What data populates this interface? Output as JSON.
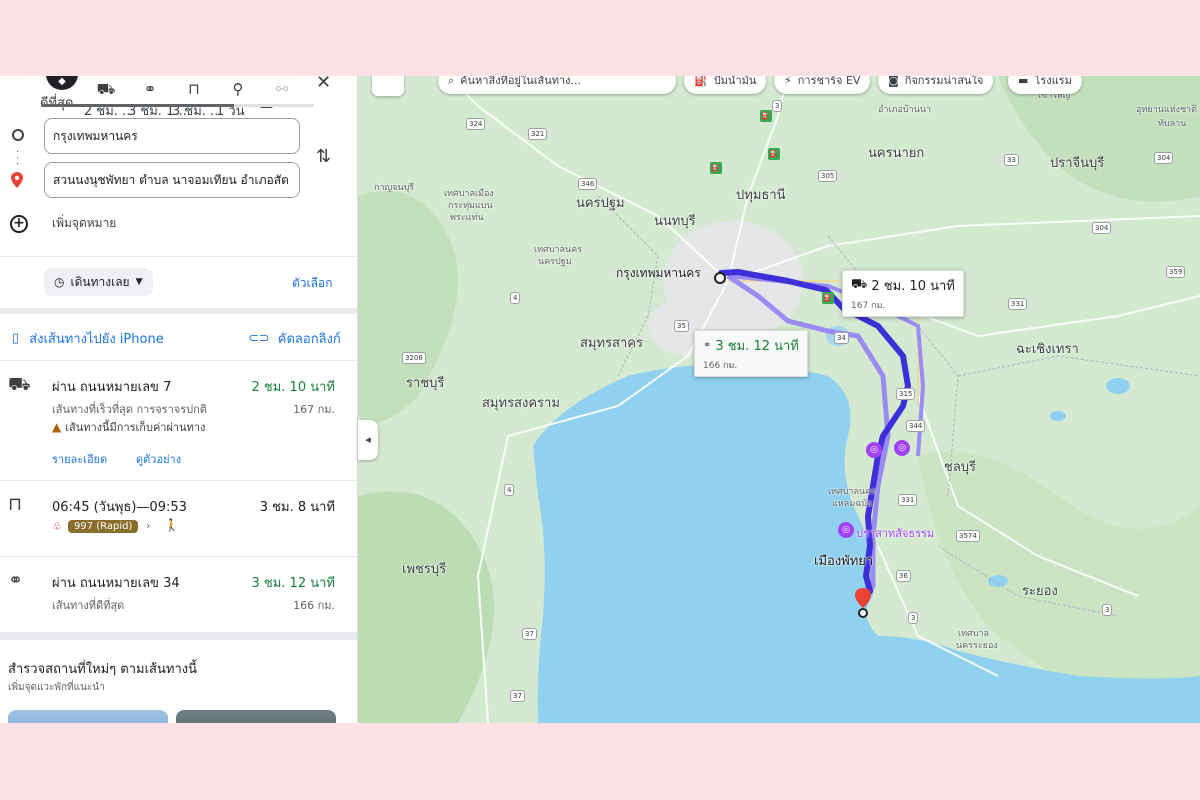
{
  "sidebar": {
    "modes": [
      {
        "label": "ดีที่สุด",
        "icon": "best-route-icon",
        "glyph": "◆"
      },
      {
        "label": "2 ชม. ...",
        "icon": "car-icon",
        "glyph": "🚗"
      },
      {
        "label": "3 ชม. 1...",
        "icon": "motorcycle-icon",
        "glyph": "🏍"
      },
      {
        "label": "3 ชม. ...",
        "icon": "transit-icon",
        "glyph": "🚆"
      },
      {
        "label": "1 วัน",
        "icon": "walking-icon",
        "glyph": "🚶"
      },
      {
        "label": "—",
        "icon": "bicycle-icon",
        "glyph": "🚲"
      }
    ],
    "origin": "กรุงเทพมหานคร",
    "destination": "สวนนงนุชพัทยา ตำบล นาจอมเทียน อำเภอสัต",
    "add_destination": "เพิ่มจุดหมาย",
    "depart_label": "เดินทางเลย",
    "options_label": "ตัวเลือก",
    "send_to_phone": "ส่งเส้นทางไปยัง iPhone",
    "copy_link": "คัดลอกลิงก์",
    "routes": [
      {
        "title": "ผ่าน ถนนหมายเลข 7",
        "time": "2 ชม. 10 นาที",
        "subtitle": "เส้นทางที่เร็วที่สุด การจราจรปกติ",
        "distance": "167 กม.",
        "warning": "เส้นทางนี้มีการเก็บค่าผ่านทาง",
        "details": "รายละเอียด",
        "preview": "ดูตัวอย่าง"
      },
      {
        "title": "06:45 (วันพุธ)—09:53",
        "time": "3 ชม. 8 นาที",
        "bus": "997 (Rapid)"
      },
      {
        "title": "ผ่าน ถนนหมายเลข 34",
        "time": "3 ชม. 12 นาที",
        "subtitle": "เส้นทางที่ดีที่สุด",
        "distance": "166 กม."
      }
    ],
    "explore_title": "สำรวจสถานที่ใหม่ๆ ตามเส้นทางนี้",
    "explore_sub": "เพิ่มจุดแวะพักที่แนะนำ"
  },
  "map": {
    "search_placeholder": "ค้นหาสิ่งที่อยู่ในเส้นทาง...",
    "chips": [
      "ปั๊มน้ำมัน",
      "การชาร์จ EV",
      "กิจกรรมน่าสนใจ",
      "โรงแรม"
    ],
    "callout_main": {
      "time": "2 ชม. 10 นาที",
      "distance": "167 กม."
    },
    "callout_alt": {
      "time": "3 ชม. 12 นาที",
      "distance": "166 กม."
    },
    "labels": {
      "bangkok": "กรุงเทพมหานคร",
      "pathum": "ปทุมธานี",
      "nonthaburi": "นนทบุรี",
      "nakhon_pathom": "นครปฐม",
      "samut_sakhon": "สมุทรสาคร",
      "samut_songkhram": "สมุทรสงคราม",
      "ratchaburi": "ราชบุรี",
      "phetchaburi": "เพชรบุรี",
      "nakhon_nayok": "นครนายก",
      "prachinburi": "ปราจีนบุรี",
      "chachoengsao": "ฉะเชิงเทรา",
      "chonburi": "ชลบุรี",
      "rayong": "ระยอง",
      "pattaya": "เมืองพัทยา",
      "sanctuary": "ปราสาทสัจธรรม",
      "kanchanaburi": "กาญจนบุรี",
      "t_muang": "เทศบาลเมือง",
      "t_kratumbaen": "กระทุ่มแบน",
      "t_prapadaeng": "พระแท่น",
      "t_nakhon": "เทศบาลนคร",
      "t_nakhonpathom": "นครปฐม",
      "t_laemchabang": "แหลมฉบัง",
      "t_nakhonrayong": "นครระยอง",
      "t_ban_na": "อำเภอบ้านนา",
      "t_khao_yai": "เขาใหญ่",
      "t_uthai": "อุทยานแห่งชาติ",
      "t_thap_lan": "ทับลาน",
      "t_nakhonlaem": "เทศบาลนคร",
      "t_rayong_mun": "เทศบาล"
    },
    "shields": [
      "324",
      "321",
      "346",
      "305",
      "3",
      "33",
      "304",
      "304",
      "359",
      "331",
      "4",
      "35",
      "34",
      "3208",
      "315",
      "344",
      "331",
      "3574",
      "4",
      "36",
      "3",
      "37",
      "37",
      "3"
    ]
  }
}
